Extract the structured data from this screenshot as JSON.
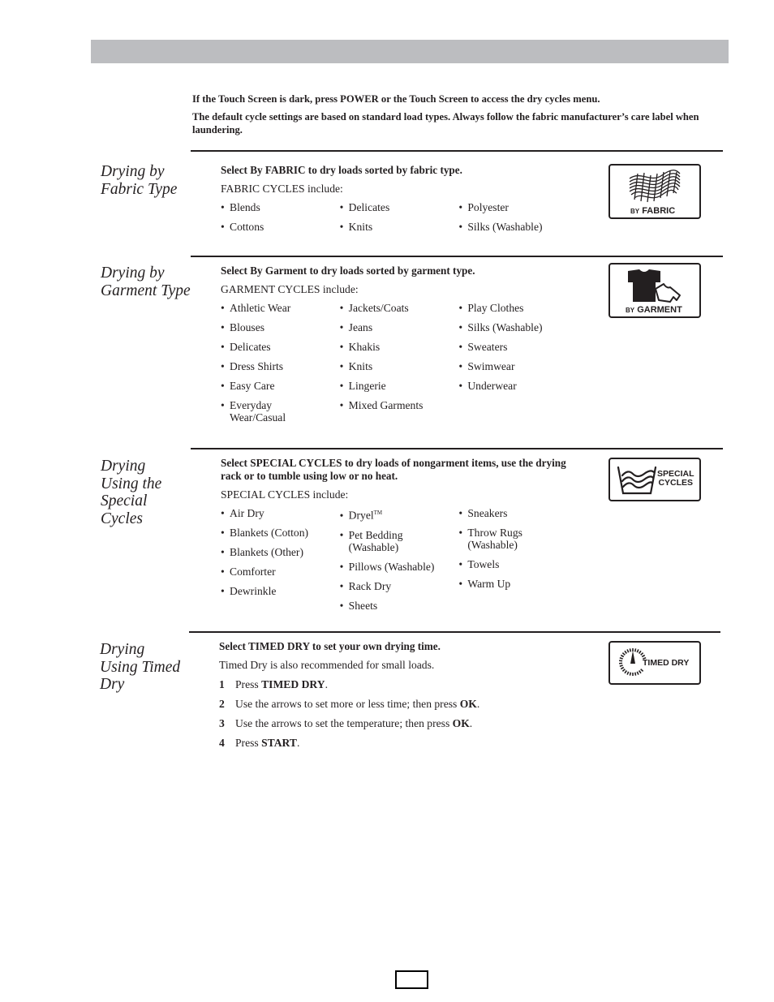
{
  "intro": {
    "line1": "If the Touch Screen is dark, press POWER or the Touch Screen to access the dry cycles menu.",
    "line2": "The default cycle settings are based on standard load types. Always follow the fabric manufacturer’s care label when laundering."
  },
  "sections": [
    {
      "title": "Drying by Fabric Type",
      "lead": "Select By FABRIC to dry loads sorted by fabric type.",
      "subhead": "FABRIC CYCLES include:",
      "columns": [
        [
          "Blends",
          "Cottons"
        ],
        [
          "Delicates",
          "Knits"
        ],
        [
          "Polyester",
          "Silks (Washable)"
        ]
      ],
      "icon": {
        "name": "fabric-weave-icon",
        "label_small": "BY",
        "label": "FABRIC"
      }
    },
    {
      "title": "Drying by Garment Type",
      "lead": "Select By Garment to dry loads sorted by garment type.",
      "subhead": "GARMENT CYCLES include:",
      "columns": [
        [
          "Athletic Wear",
          "Blouses",
          "Delicates",
          "Dress Shirts",
          "Easy Care",
          "Everyday Wear/Casual"
        ],
        [
          "Jackets/Coats",
          "Jeans",
          "Khakis",
          "Knits",
          "Lingerie",
          "Mixed Garments"
        ],
        [
          "Play Clothes",
          "Silks (Washable)",
          "Sweaters",
          "Swimwear",
          "Underwear"
        ]
      ],
      "icon": {
        "name": "tshirt-icon",
        "label_small": "BY",
        "label": "GARMENT"
      }
    },
    {
      "title": "Drying Using the Special Cycles",
      "lead": "Select SPECIAL CYCLES to dry loads of nongarment items, use the drying rack or to tumble using low or no heat.",
      "subhead": "SPECIAL CYCLES include:",
      "columns": [
        [
          "Air Dry",
          "Blankets (Cotton)",
          "Blankets (Other)",
          "Comforter",
          "Dewrinkle"
        ],
        [
          "Dryel",
          "Pet Bedding (Washable)",
          "Pillows (Washable)",
          "Rack Dry",
          "Sheets"
        ],
        [
          "Sneakers",
          "Throw Rugs (Washable)",
          "Towels",
          "Warm Up"
        ]
      ],
      "trademark": "TM",
      "icon": {
        "name": "wash-tub-icon",
        "label_line1": "SPECIAL",
        "label_line2": "CYCLES"
      }
    },
    {
      "title": "Drying Using Timed Dry",
      "lead": "Select TIMED DRY to set your own drying time.",
      "subhead": "Timed Dry is also recommended for small loads.",
      "steps": [
        {
          "num": "1",
          "pre": "Press ",
          "bold": "TIMED DRY",
          "post": "."
        },
        {
          "num": "2",
          "pre": "Use the arrows to set more or less time; then press ",
          "bold": "OK",
          "post": "."
        },
        {
          "num": "3",
          "pre": "Use the arrows to set the temperature; then press ",
          "bold": "OK",
          "post": "."
        },
        {
          "num": "4",
          "pre": "Press ",
          "bold": "START",
          "post": "."
        }
      ],
      "icon": {
        "name": "dial-timer-icon",
        "label": "TIMED DRY"
      }
    }
  ],
  "page_number": ""
}
